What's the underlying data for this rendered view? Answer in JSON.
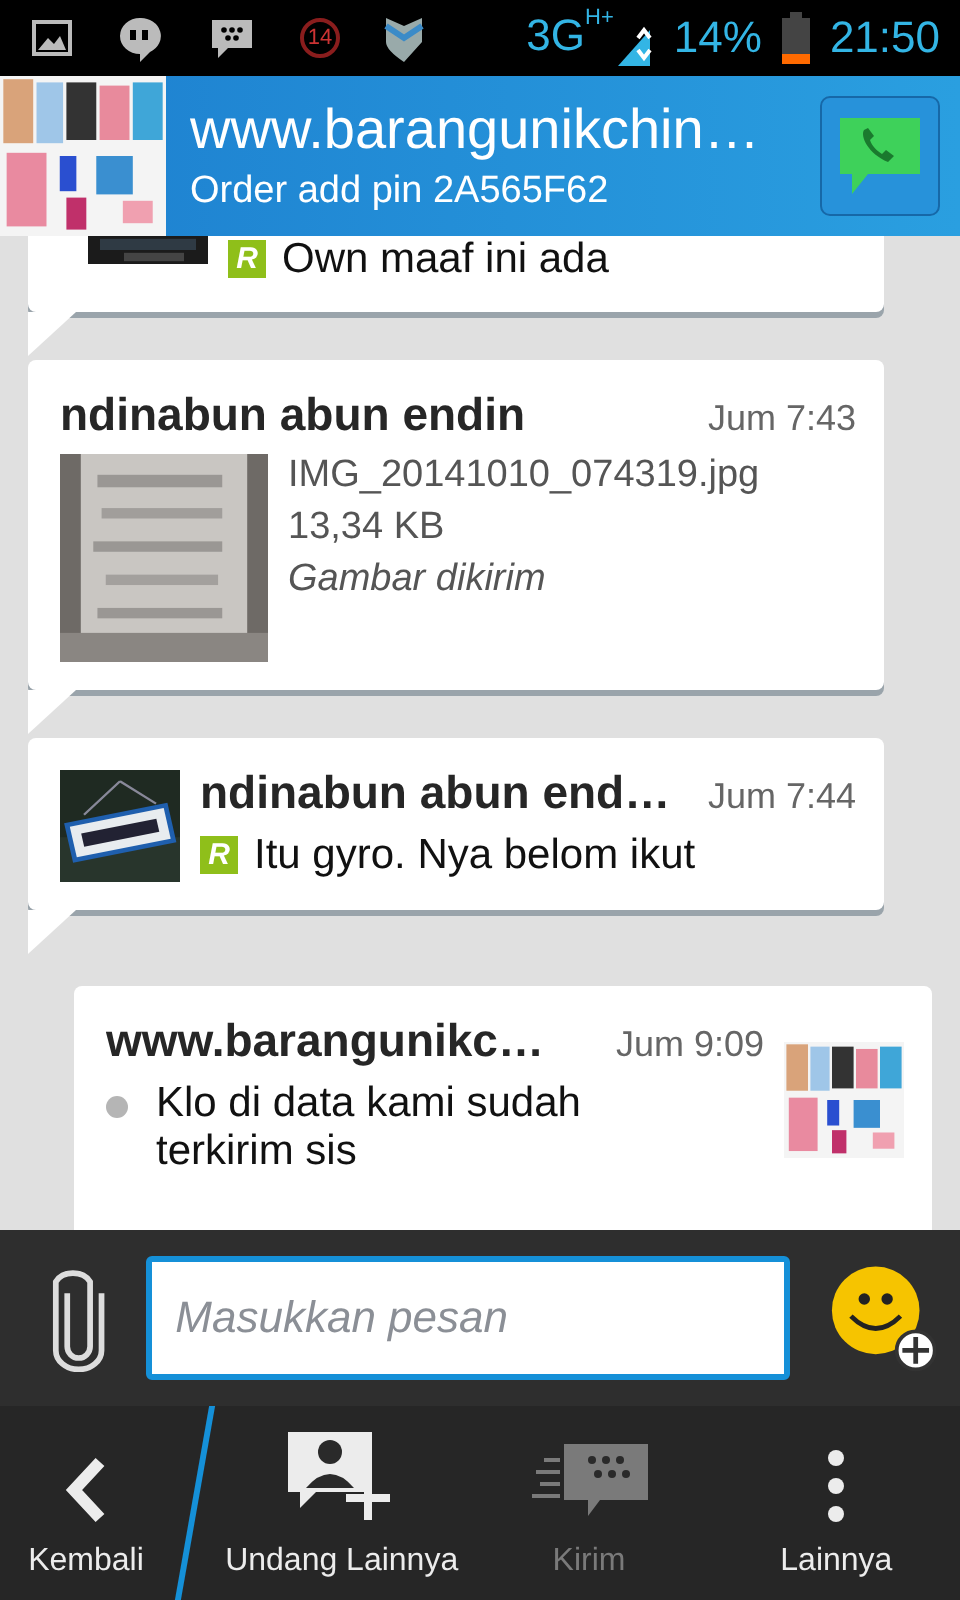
{
  "status_bar": {
    "notification_count": "14",
    "network": "3G",
    "network_type": "H+",
    "battery": "14%",
    "time": "21:50"
  },
  "header": {
    "title": "www.barangunikchin…",
    "subtitle": "Order add pin 2A565F62"
  },
  "messages": [
    {
      "kind": "incoming",
      "read_mark": "R",
      "text": "Own maaf ini ada"
    },
    {
      "kind": "incoming",
      "sender": "ndinabun abun endin",
      "time": "Jum 7:43",
      "attachment": {
        "kind": "picture",
        "filename": "IMG_20141010_074319.jpg",
        "size": "13,34 KB",
        "caption": "Gambar dikirim"
      }
    },
    {
      "kind": "incoming",
      "sender": "ndinabun abun end…",
      "time": "Jum 7:44",
      "read_mark": "R",
      "text": "Itu gyro. Nya belom ikut"
    },
    {
      "kind": "outgoing",
      "sender": "www.barangunikc…",
      "time": "Jum 9:09",
      "delivered": true,
      "text": "Klo di data kami sudah terkirim sis"
    }
  ],
  "compose": {
    "placeholder": "Masukkan pesan"
  },
  "nav": [
    {
      "kind": "back",
      "label": "Kembali",
      "disabled": false
    },
    {
      "kind": "invite",
      "label": "Undang Lainnya",
      "disabled": false
    },
    {
      "kind": "send",
      "label": "Kirim",
      "disabled": true
    },
    {
      "kind": "more",
      "label": "Lainnya",
      "disabled": false
    }
  ]
}
